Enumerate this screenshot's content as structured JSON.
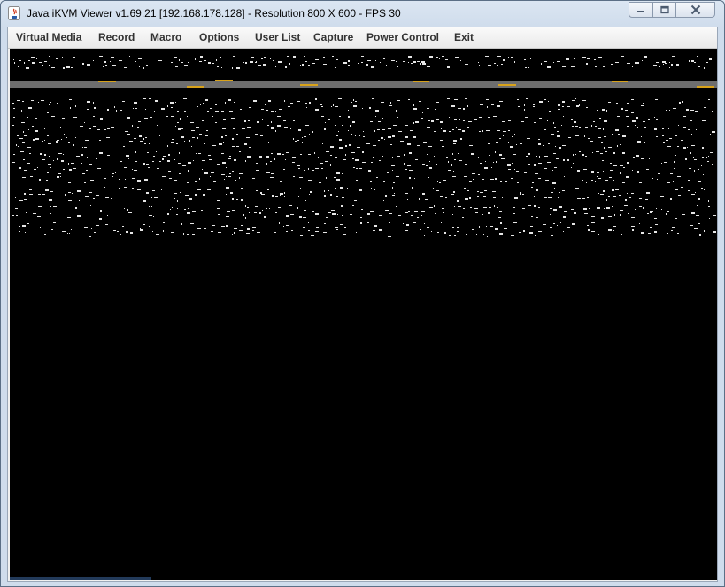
{
  "window": {
    "title": "Java iKVM Viewer v1.69.21 [192.168.178.128]  - Resolution 800 X 600 - FPS 30",
    "icons": {
      "app": "java-icon",
      "minimize": "minimize-icon",
      "maximize": "maximize-icon",
      "close": "close-icon"
    }
  },
  "menu": {
    "items": [
      {
        "label": "Virtual Media"
      },
      {
        "label": "Record"
      },
      {
        "label": "Macro"
      },
      {
        "label": "Options"
      },
      {
        "label": "User List"
      },
      {
        "label": "Capture"
      },
      {
        "label": "Power Control"
      },
      {
        "label": "Exit"
      }
    ]
  },
  "remote_screen": {
    "background": "#000000",
    "band_color": "#6e6e6e",
    "accent_color": "#d8a21a"
  }
}
